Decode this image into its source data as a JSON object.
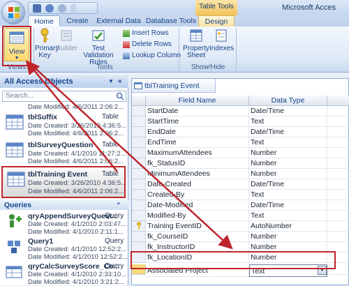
{
  "window": {
    "title": "Microsoft Acces",
    "contextual_tab_group": "Table Tools"
  },
  "ribbon_tabs": [
    "Home",
    "Create",
    "External Data",
    "Database Tools",
    "Design"
  ],
  "ribbon": {
    "views": {
      "view_label": "View",
      "group_label": "Views"
    },
    "tools": {
      "primary_key": "Primary Key",
      "builder": "Builder",
      "test_rules": "Test Validation Rules",
      "insert_rows": "Insert Rows",
      "delete_rows": "Delete Rows",
      "lookup_column": "Lookup Column",
      "group_label": "Tools"
    },
    "show_hide": {
      "property_sheet": "Property Sheet",
      "indexes": "Indexes",
      "group_label": "Show/Hide"
    }
  },
  "nav_pane": {
    "header": "All Access Objects",
    "search_placeholder": "Search...",
    "tables": [
      {
        "name": "tblSuffix",
        "kind": "Table",
        "created": "Date Created: 3/26/2010 4:36:5...",
        "modified": "Date Modified: 4/6/2011 2:06:2..."
      },
      {
        "name": "tblSurveyQuestion",
        "kind": "Table",
        "created": "Date Created: 4/1/2010 11:27:2...",
        "modified": "Date Modified: 4/6/2011 2:06:2..."
      },
      {
        "name": "tblTraining Event",
        "kind": "Table",
        "created": "Date Created: 3/26/2010 4:36:5...",
        "modified": "Date Modified: 4/6/2011 2:06:2..."
      }
    ],
    "top_partial_line": "Date Modified: 4/6/2011 2:06:2...",
    "queries_header": "Queries",
    "queries": [
      {
        "name": "qryAppendSurveyQuest...",
        "kind": "Query",
        "created": "Date Created: 4/1/2010 2:03:47...",
        "modified": "Date Modified: 4/1/2010 2:11:1..."
      },
      {
        "name": "Query1",
        "kind": "Query",
        "created": "Date Created: 4/1/2010 12:52:2...",
        "modified": "Date Modified: 4/1/2010 12:52:2..."
      },
      {
        "name": "qryCalcSurveyScore_Co...",
        "kind": "Query",
        "created": "Date Created: 4/1/2010 2:33:10...",
        "modified": "Date Modified: 4/1/2010 3:21:2..."
      }
    ]
  },
  "design_view": {
    "tab_title": "tblTraining Event",
    "columns": [
      "Field Name",
      "Data Type"
    ],
    "rows": [
      {
        "field": "StartDate",
        "type": "Date/Time"
      },
      {
        "field": "StartTime",
        "type": "Text"
      },
      {
        "field": "EndDate",
        "type": "Date/Time"
      },
      {
        "field": "EndTime",
        "type": "Text"
      },
      {
        "field": "MaximumAttendees",
        "type": "Number"
      },
      {
        "field": "fk_StatusID",
        "type": "Number"
      },
      {
        "field": "MinimumAttendees",
        "type": "Number"
      },
      {
        "field": "Date-Created",
        "type": "Date/Time"
      },
      {
        "field": "Created-By",
        "type": "Text"
      },
      {
        "field": "Date-Modified",
        "type": "Date/Time"
      },
      {
        "field": "Modified-By",
        "type": "Text"
      },
      {
        "field": "Training EventID",
        "type": "AutoNumber"
      },
      {
        "field": "fk_CourseID",
        "type": "Number"
      },
      {
        "field": "fk_InstructorID",
        "type": "Number"
      },
      {
        "field": "fk_LocationID",
        "type": "Number"
      },
      {
        "field": "Associated Project",
        "type": "Text"
      }
    ]
  },
  "colors": {
    "highlight_red": "#c0242b",
    "ribbon_blue": "#15428b"
  }
}
